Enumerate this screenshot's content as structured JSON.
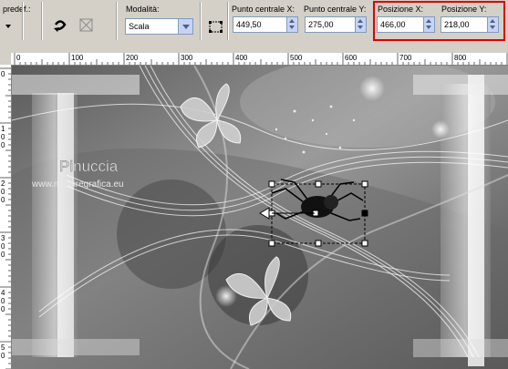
{
  "toolbar": {
    "preset_label": "predef.:",
    "mode_label": "Modalità:",
    "mode_value": "Scala",
    "center_x_label": "Punto centrale X:",
    "center_x_value": "449,50",
    "center_y_label": "Punto centrale Y:",
    "center_y_value": "275,00",
    "pos_x_label": "Posizione X:",
    "pos_x_value": "466,00",
    "pos_y_label": "Posizione Y:",
    "pos_y_value": "218,00",
    "highlight_color": "#e00000"
  },
  "ruler_h": {
    "labels": [
      "0",
      "100",
      "200",
      "300",
      "400",
      "500",
      "600",
      "700",
      "800"
    ]
  },
  "ruler_v": {
    "labels": [
      "0",
      "1 0 0",
      "2 0 0",
      "3 0 0",
      "4 0 0",
      "5 0"
    ]
  },
  "canvas": {
    "watermark_title": "Pinuccia",
    "watermark_url": "www.maidiregrafica.eu"
  },
  "icons": {
    "preset": "preset-picker-icon",
    "reset": "reset-icon",
    "undo": "undo-icon",
    "transform": "transform-icon"
  }
}
